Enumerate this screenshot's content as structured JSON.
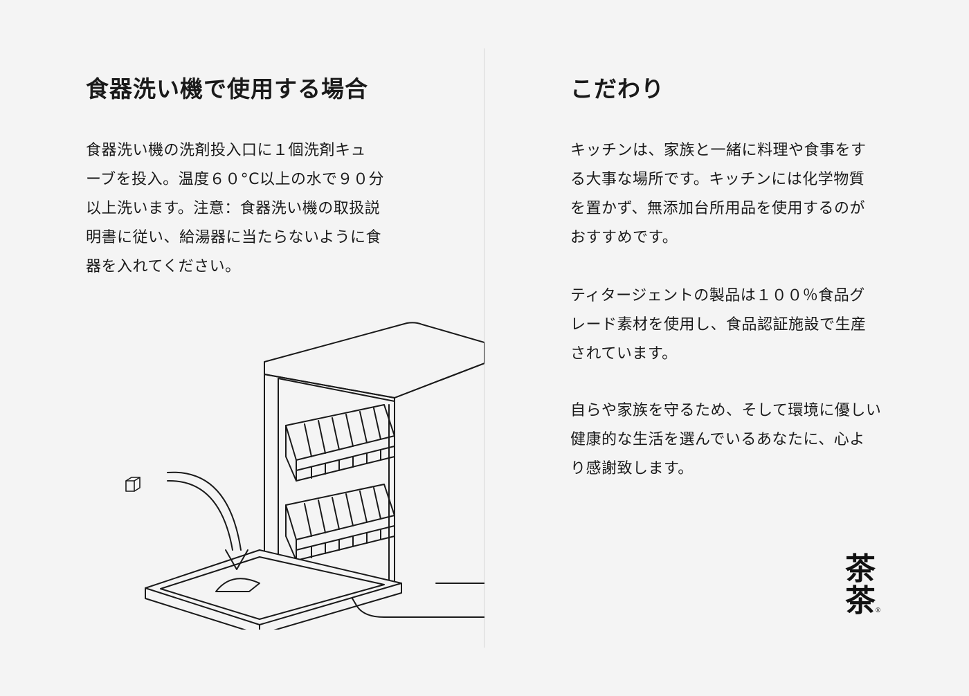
{
  "left": {
    "heading": "食器洗い機で使用する場合",
    "lines": [
      "食器洗い機の洗剤投入口に１個洗剤キュ",
      "ーブを投入。温度６０°C以上の水で９０分",
      "以上洗います。注意：食器洗い機の取扱説",
      "明書に従い、給湯器に当たらないように食",
      "器を入れてください。"
    ]
  },
  "right": {
    "heading": "こだわり",
    "paragraph1": [
      "キッチンは、家族と一緒に料理や食事をす",
      "る大事な場所です。キッチンには化学物質",
      "を置かず、無添加台所用品を使用するのが",
      "おすすめです。"
    ],
    "paragraph2": [
      "ティタージェントの製品は１００％食品グ",
      "レード素材を使用し、食品認証施設で生産",
      "されています。"
    ],
    "paragraph3": [
      "自らや家族を守るため、そして環境に優しい",
      "健康的な生活を選んでいるあなたに、心よ",
      "り感謝致します。"
    ]
  },
  "logo": {
    "char_top": "茶",
    "char_bottom": "茶",
    "registered": "®"
  }
}
